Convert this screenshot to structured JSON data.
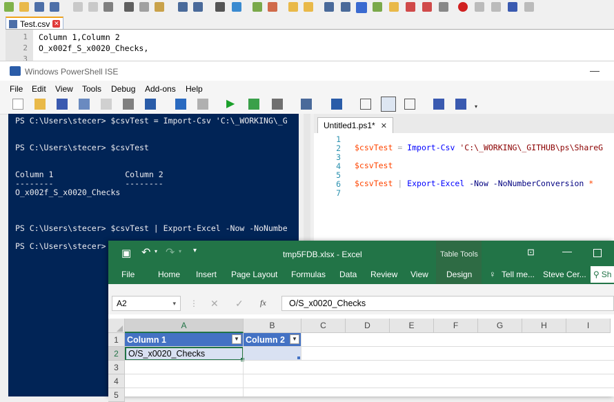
{
  "npp": {
    "tab_label": "Test.csv",
    "lines": [
      {
        "num": "1",
        "text": "Column 1,Column 2"
      },
      {
        "num": "2",
        "text": "O_x002f_S_x0020_Checks,"
      },
      {
        "num": "3",
        "text": ""
      }
    ]
  },
  "ise": {
    "title": "Windows PowerShell ISE",
    "minimize": "—",
    "menu": [
      "File",
      "Edit",
      "View",
      "Tools",
      "Debug",
      "Add-ons",
      "Help"
    ],
    "console_lines": [
      "PS C:\\Users\\stecer> $csvTest = Import-Csv 'C:\\_WORKING\\_G",
      "",
      "PS C:\\Users\\stecer> $csvTest",
      "",
      "Column 1               Column 2",
      "--------               --------",
      "O_x002f_S_x0020_Checks",
      "",
      "",
      "PS C:\\Users\\stecer> $csvTest | Export-Excel -Now -NoNumbe",
      "",
      "PS C:\\Users\\stecer>"
    ],
    "script_tab": "Untitled1.ps1*",
    "script_tab_close": "✕",
    "script_line_numbers": [
      "1",
      "2",
      "3",
      "4",
      "5",
      "6",
      "7"
    ],
    "script_lines": {
      "l2_var": "$csvTest",
      "l2_op": " = ",
      "l2_cmd": "Import-Csv",
      "l2_str": " 'C:\\_WORKING\\_GITHUB\\ps\\ShareG",
      "l4_var": "$csvTest",
      "l6_var": "$csvTest",
      "l6_pipe": " | ",
      "l6_cmd": "Export-Excel",
      "l6_params": " -Now -NoNumberConversion",
      "l6_star": " *"
    }
  },
  "excel": {
    "title": "tmp5FDB.xlsx - Excel",
    "table_tools": "Table Tools",
    "tabs": [
      "File",
      "Home",
      "Insert",
      "Page Layout",
      "Formulas",
      "Data",
      "Review",
      "View",
      "Design"
    ],
    "tell_me": "Tell me...",
    "user": "Steve Cer...",
    "share_fragment": "Sh",
    "name_box": "A2",
    "fx": "fx",
    "formula_value": "O/S_x0020_Checks",
    "columns": [
      "A",
      "B",
      "C",
      "D",
      "E",
      "F",
      "G",
      "H",
      "I"
    ],
    "rows": [
      "1",
      "2",
      "3",
      "4",
      "5"
    ],
    "cells": {
      "A1": "Column 1",
      "B1": "Column 2",
      "A2": "O/S_x0020_Checks"
    }
  },
  "colors": {
    "excel_green": "#227447",
    "ps_blue": "#012456",
    "table_header": "#4472c4",
    "table_band": "#d9e1f2"
  }
}
